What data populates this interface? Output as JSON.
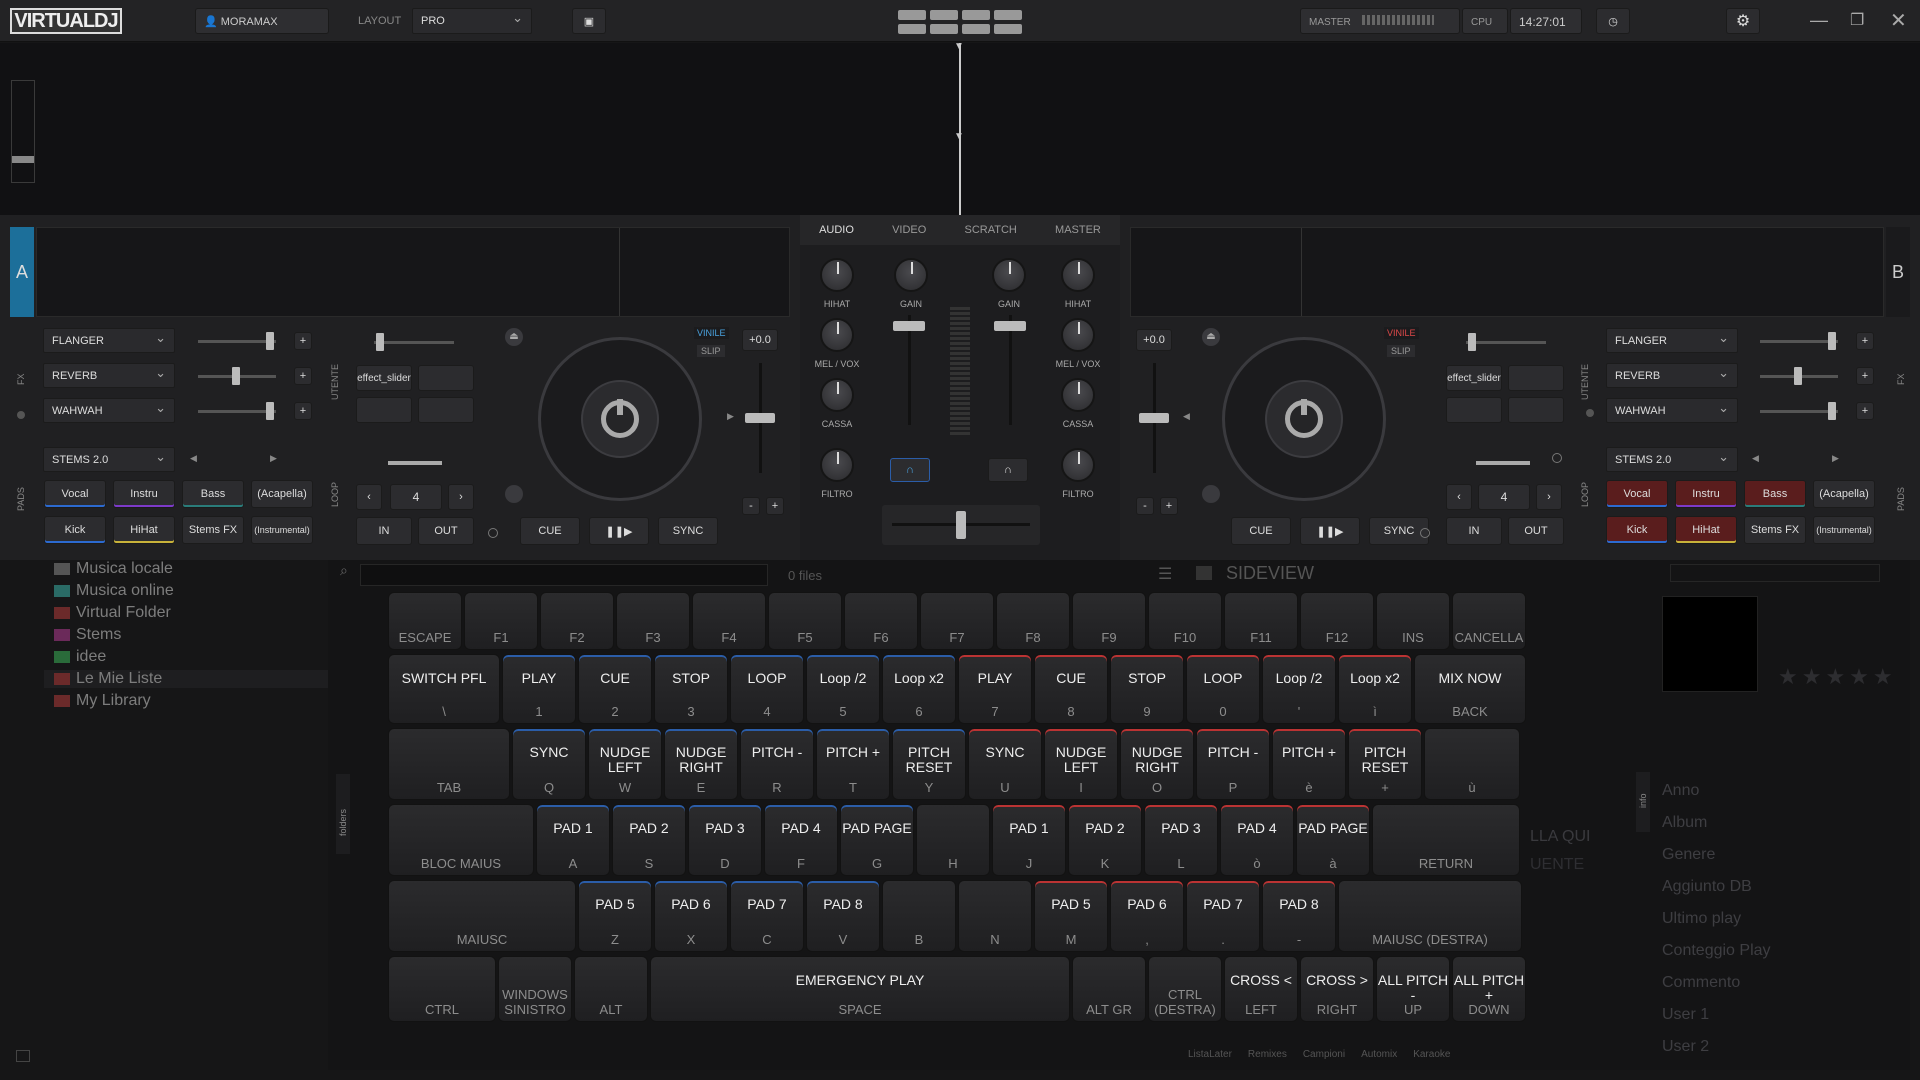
{
  "topbar": {
    "logo": "VIRTUALDJ",
    "user": "MORAMAX",
    "layout_label": "LAYOUT",
    "layout_value": "PRO",
    "master_label": "MASTER",
    "cpu_label": "CPU",
    "clock": "14:27:01"
  },
  "deckA": {
    "letter": "A",
    "fx": [
      "FLANGER",
      "REVERB",
      "WAHWAH"
    ],
    "fx_label": "FX",
    "utente_label": "UTENTE",
    "effect_slider": "effect_slider",
    "vinile": "VINILE",
    "slip": "SLIP",
    "pitch": "+0.0",
    "stems": "STEMS 2.0",
    "pads_label": "PADS",
    "loop_label": "LOOP",
    "pads": [
      "Vocal",
      "Instru",
      "Bass",
      "(Acapella)",
      "Kick",
      "HiHat",
      "Stems FX",
      "(Instrumental)"
    ],
    "loop_value": "4",
    "in": "IN",
    "out": "OUT",
    "cue": "CUE",
    "play": "❚❚▶",
    "sync": "SYNC",
    "minus": "-",
    "plus": "+"
  },
  "deckB": {
    "letter": "B",
    "fx": [
      "FLANGER",
      "REVERB",
      "WAHWAH"
    ],
    "fx_label": "FX",
    "utente_label": "UTENTE",
    "effect_slider": "effect_slider",
    "vinile": "VINILE",
    "slip": "SLIP",
    "pitch": "+0.0",
    "stems": "STEMS 2.0",
    "pads_label": "PADS",
    "loop_label": "LOOP",
    "pads": [
      "Vocal",
      "Instru",
      "Bass",
      "(Acapella)",
      "Kick",
      "HiHat",
      "Stems FX",
      "(Instrumental)"
    ],
    "loop_value": "4",
    "in": "IN",
    "out": "OUT",
    "cue": "CUE",
    "play": "❚❚▶",
    "sync": "SYNC",
    "minus": "-",
    "plus": "+"
  },
  "mixer": {
    "tabs": [
      "AUDIO",
      "VIDEO",
      "SCRATCH",
      "MASTER"
    ],
    "hihat": "HIHAT",
    "gain": "GAIN",
    "melvox": "MEL / VOX",
    "cassa": "CASSA",
    "filtro": "FILTRO"
  },
  "browser": {
    "folders": [
      "Musica locale",
      "Musica online",
      "Virtual Folder",
      "Stems",
      "idee",
      "Le Mie Liste",
      "My Library"
    ],
    "files": "0 files",
    "sideview": "SIDEVIEW",
    "folders_label": "folders",
    "info_label": "info",
    "drop_text1": "LLA QUI",
    "drop_text2": "UENTE",
    "metadata": [
      "Anno",
      "Album",
      "Genere",
      "Aggiunto DB",
      "Ultimo play",
      "Conteggio Play",
      "Commento",
      "User 1",
      "User 2"
    ],
    "bottom_tabs": [
      "ListaLater",
      "Remixes",
      "Campioni",
      "Automix",
      "Karaoke"
    ]
  },
  "keyboard": {
    "rows": [
      [
        [
          "",
          "ESCAPE"
        ],
        [
          "",
          "F1"
        ],
        [
          "",
          "F2"
        ],
        [
          "",
          "F3"
        ],
        [
          "",
          "F4"
        ],
        [
          "",
          "F5"
        ],
        [
          "",
          "F6"
        ],
        [
          "",
          "F7"
        ],
        [
          "",
          "F8"
        ],
        [
          "",
          "F9"
        ],
        [
          "",
          "F10"
        ],
        [
          "",
          "F11"
        ],
        [
          "",
          "F12"
        ],
        [
          "",
          "INS"
        ],
        [
          "",
          "CANCELLA"
        ]
      ],
      [
        [
          "SWITCH PFL",
          "\\"
        ],
        [
          "PLAY",
          "1"
        ],
        [
          "CUE",
          "2"
        ],
        [
          "STOP",
          "3"
        ],
        [
          "LOOP",
          "4"
        ],
        [
          "Loop /2",
          "5"
        ],
        [
          "Loop x2",
          "6"
        ],
        [
          "PLAY",
          "7"
        ],
        [
          "CUE",
          "8"
        ],
        [
          "STOP",
          "9"
        ],
        [
          "LOOP",
          "0"
        ],
        [
          "Loop /2",
          "'"
        ],
        [
          "Loop x2",
          "ì"
        ],
        [
          "MIX NOW",
          "BACK"
        ]
      ],
      [
        [
          "",
          "TAB"
        ],
        [
          "SYNC",
          "Q"
        ],
        [
          "NUDGE LEFT",
          "W"
        ],
        [
          "NUDGE RIGHT",
          "E"
        ],
        [
          "PITCH -",
          "R"
        ],
        [
          "PITCH +",
          "T"
        ],
        [
          "PITCH RESET",
          "Y"
        ],
        [
          "SYNC",
          "U"
        ],
        [
          "NUDGE LEFT",
          "I"
        ],
        [
          "NUDGE RIGHT",
          "O"
        ],
        [
          "PITCH -",
          "P"
        ],
        [
          "PITCH +",
          "è"
        ],
        [
          "PITCH RESET",
          "+"
        ],
        [
          "",
          "ù"
        ]
      ],
      [
        [
          "",
          "BLOC MAIUS"
        ],
        [
          "PAD 1",
          "A"
        ],
        [
          "PAD 2",
          "S"
        ],
        [
          "PAD 3",
          "D"
        ],
        [
          "PAD 4",
          "F"
        ],
        [
          "PAD PAGE",
          "G"
        ],
        [
          "",
          "H"
        ],
        [
          "PAD 1",
          "J"
        ],
        [
          "PAD 2",
          "K"
        ],
        [
          "PAD 3",
          "L"
        ],
        [
          "PAD 4",
          "ò"
        ],
        [
          "PAD PAGE",
          "à"
        ],
        [
          "",
          "RETURN"
        ]
      ],
      [
        [
          "",
          "MAIUSC"
        ],
        [
          "PAD 5",
          "Z"
        ],
        [
          "PAD 6",
          "X"
        ],
        [
          "PAD 7",
          "C"
        ],
        [
          "PAD 8",
          "V"
        ],
        [
          "",
          "B"
        ],
        [
          "",
          "N"
        ],
        [
          "PAD 5",
          "M"
        ],
        [
          "PAD 6",
          ","
        ],
        [
          "PAD 7",
          "."
        ],
        [
          "PAD 8",
          "-"
        ],
        [
          "",
          "MAIUSC (DESTRA)"
        ]
      ],
      [
        [
          "",
          "CTRL"
        ],
        [
          "",
          "WINDOWS SINISTRO"
        ],
        [
          "",
          "ALT"
        ],
        [
          "EMERGENCY PLAY",
          "SPACE"
        ],
        [
          "",
          "ALT GR"
        ],
        [
          "",
          "CTRL (DESTRA)"
        ],
        [
          "CROSS <",
          "LEFT"
        ],
        [
          "CROSS >",
          "RIGHT"
        ],
        [
          "ALL PITCH -",
          "UP"
        ],
        [
          "ALL PITCH +",
          "DOWN"
        ]
      ]
    ]
  }
}
